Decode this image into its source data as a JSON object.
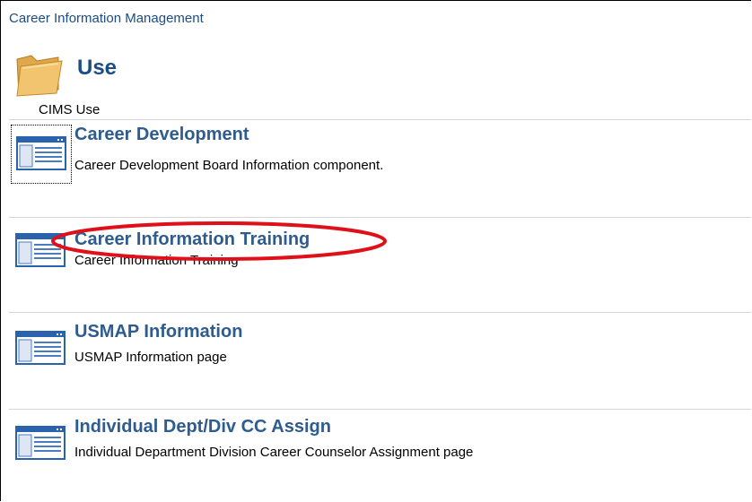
{
  "breadcrumb": "Career Information Management",
  "page": {
    "title": "Use",
    "subtitle": "CIMS Use"
  },
  "items": [
    {
      "title": "Career Development",
      "description": "Career Development Board Information component."
    },
    {
      "title": "Career Information Training",
      "description": "Career Information Training"
    },
    {
      "title": "USMAP Information",
      "description": "USMAP Information page"
    },
    {
      "title": "Individual Dept/Div CC Assign",
      "description": "Individual Department Division Career Counselor Assignment page"
    }
  ],
  "colors": {
    "link": "#2e5c8e",
    "breadcrumb": "#1c4d84",
    "annotation": "#e0101a",
    "folder": "#f2c46f"
  },
  "icons": {
    "folder": "folder-icon",
    "component": "component-page-icon"
  }
}
